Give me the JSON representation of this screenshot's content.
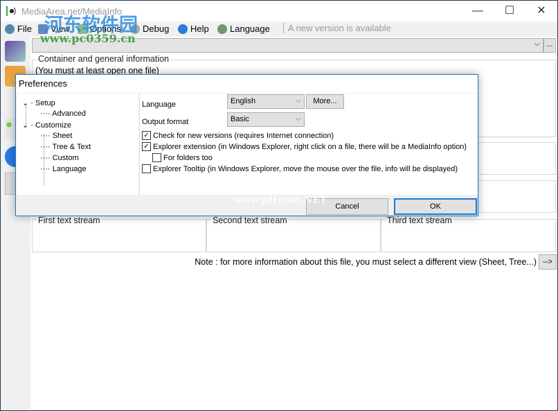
{
  "window": {
    "title": "MediaArea.net/MediaInfo",
    "minimize": "—",
    "maximize": "☐",
    "close": "✕"
  },
  "menu": {
    "items": [
      {
        "label": "File",
        "icon": "file-icon"
      },
      {
        "label": "View",
        "icon": "view-icon"
      },
      {
        "label": "Options",
        "icon": "options-icon"
      },
      {
        "label": "Debug",
        "icon": "debug-icon"
      },
      {
        "label": "Help",
        "icon": "help-icon"
      },
      {
        "label": "Language",
        "icon": "globe-icon"
      }
    ],
    "notice": "A new version is available"
  },
  "main": {
    "file_combo_arrow": "⌵",
    "browse": "...",
    "container_title": "Container and general information",
    "container_text": "(You must at least open one file)",
    "text_streams": [
      "First text stream",
      "Second text stream",
      "Third text stream"
    ],
    "note": "Note : for more information about this file, you must select a different view (Sheet, Tree...)",
    "next_button": "-->"
  },
  "dialog": {
    "title": "Preferences",
    "tree": [
      {
        "label": "Setup",
        "expanded": true,
        "children": [
          "Advanced"
        ]
      },
      {
        "label": "Customize",
        "expanded": true,
        "children": [
          "Sheet",
          "Tree & Text",
          "Custom",
          "Language"
        ]
      }
    ],
    "language_label": "Language",
    "language_value": "English",
    "more_button": "More...",
    "output_label": "Output format",
    "output_value": "Basic",
    "options": [
      {
        "label": "Check for new versions (requires Internet connection)",
        "checked": true
      },
      {
        "label": "Explorer extension (in Windows Explorer, right click on a file, there will be a MediaInfo option)",
        "checked": true
      },
      {
        "label": "For folders too",
        "checked": false
      },
      {
        "label": "Explorer Tooltip (in Windows Explorer, move the mouse over the file, info will be displayed)",
        "checked": false
      }
    ],
    "cancel": "Cancel",
    "ok": "OK"
  },
  "watermarks": {
    "cn": "河东软件园",
    "url": "www.pc0359.cn",
    "phome": "www.pHome.NET"
  },
  "colors": {
    "accent": "#1979ca",
    "watermark_blue": "#2f8fe0",
    "watermark_green": "#3a9a3a"
  }
}
